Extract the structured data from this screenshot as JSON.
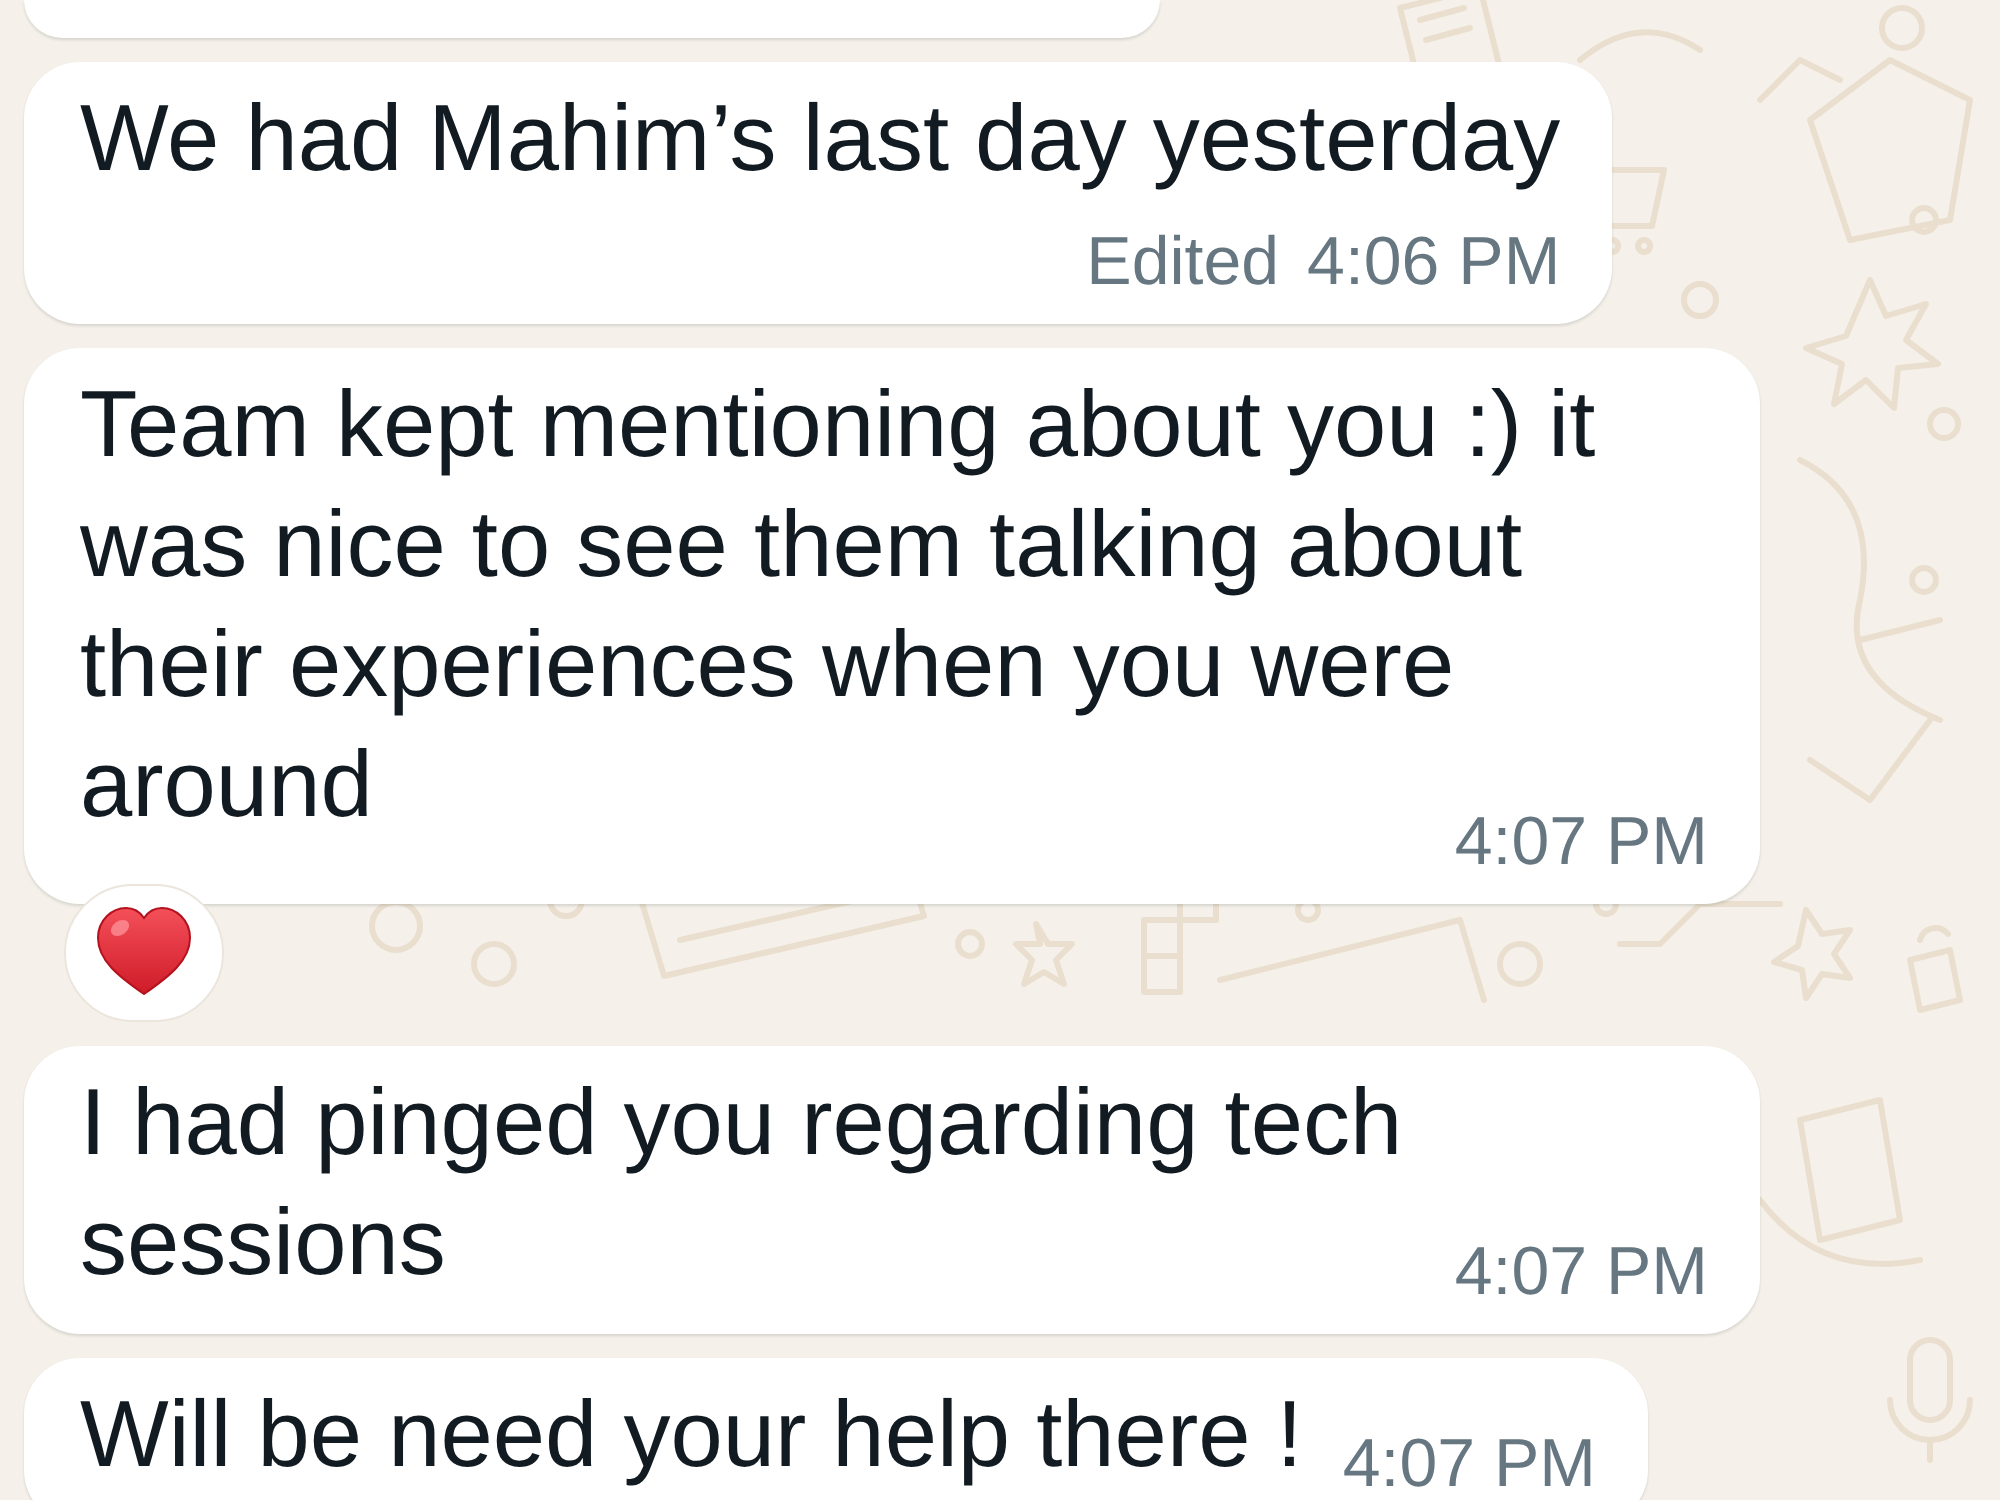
{
  "chat": {
    "messages": [
      {
        "kind": "partial"
      },
      {
        "kind": "text",
        "text": "We had Mahim’s last day yesterday",
        "edited_label": "Edited",
        "time": "4:06 PM",
        "reacted": false
      },
      {
        "kind": "text",
        "text": "Team kept mentioning about you :) it was nice to see them talking about their experiences when you were around",
        "time": "4:07 PM",
        "reacted": true
      },
      {
        "kind": "text",
        "text": "I had pinged you regarding tech sessions",
        "time": "4:07 PM",
        "reacted": false
      },
      {
        "kind": "text",
        "text": "Will be need your help there !",
        "time": "4:07 PM",
        "reacted": false
      }
    ]
  }
}
